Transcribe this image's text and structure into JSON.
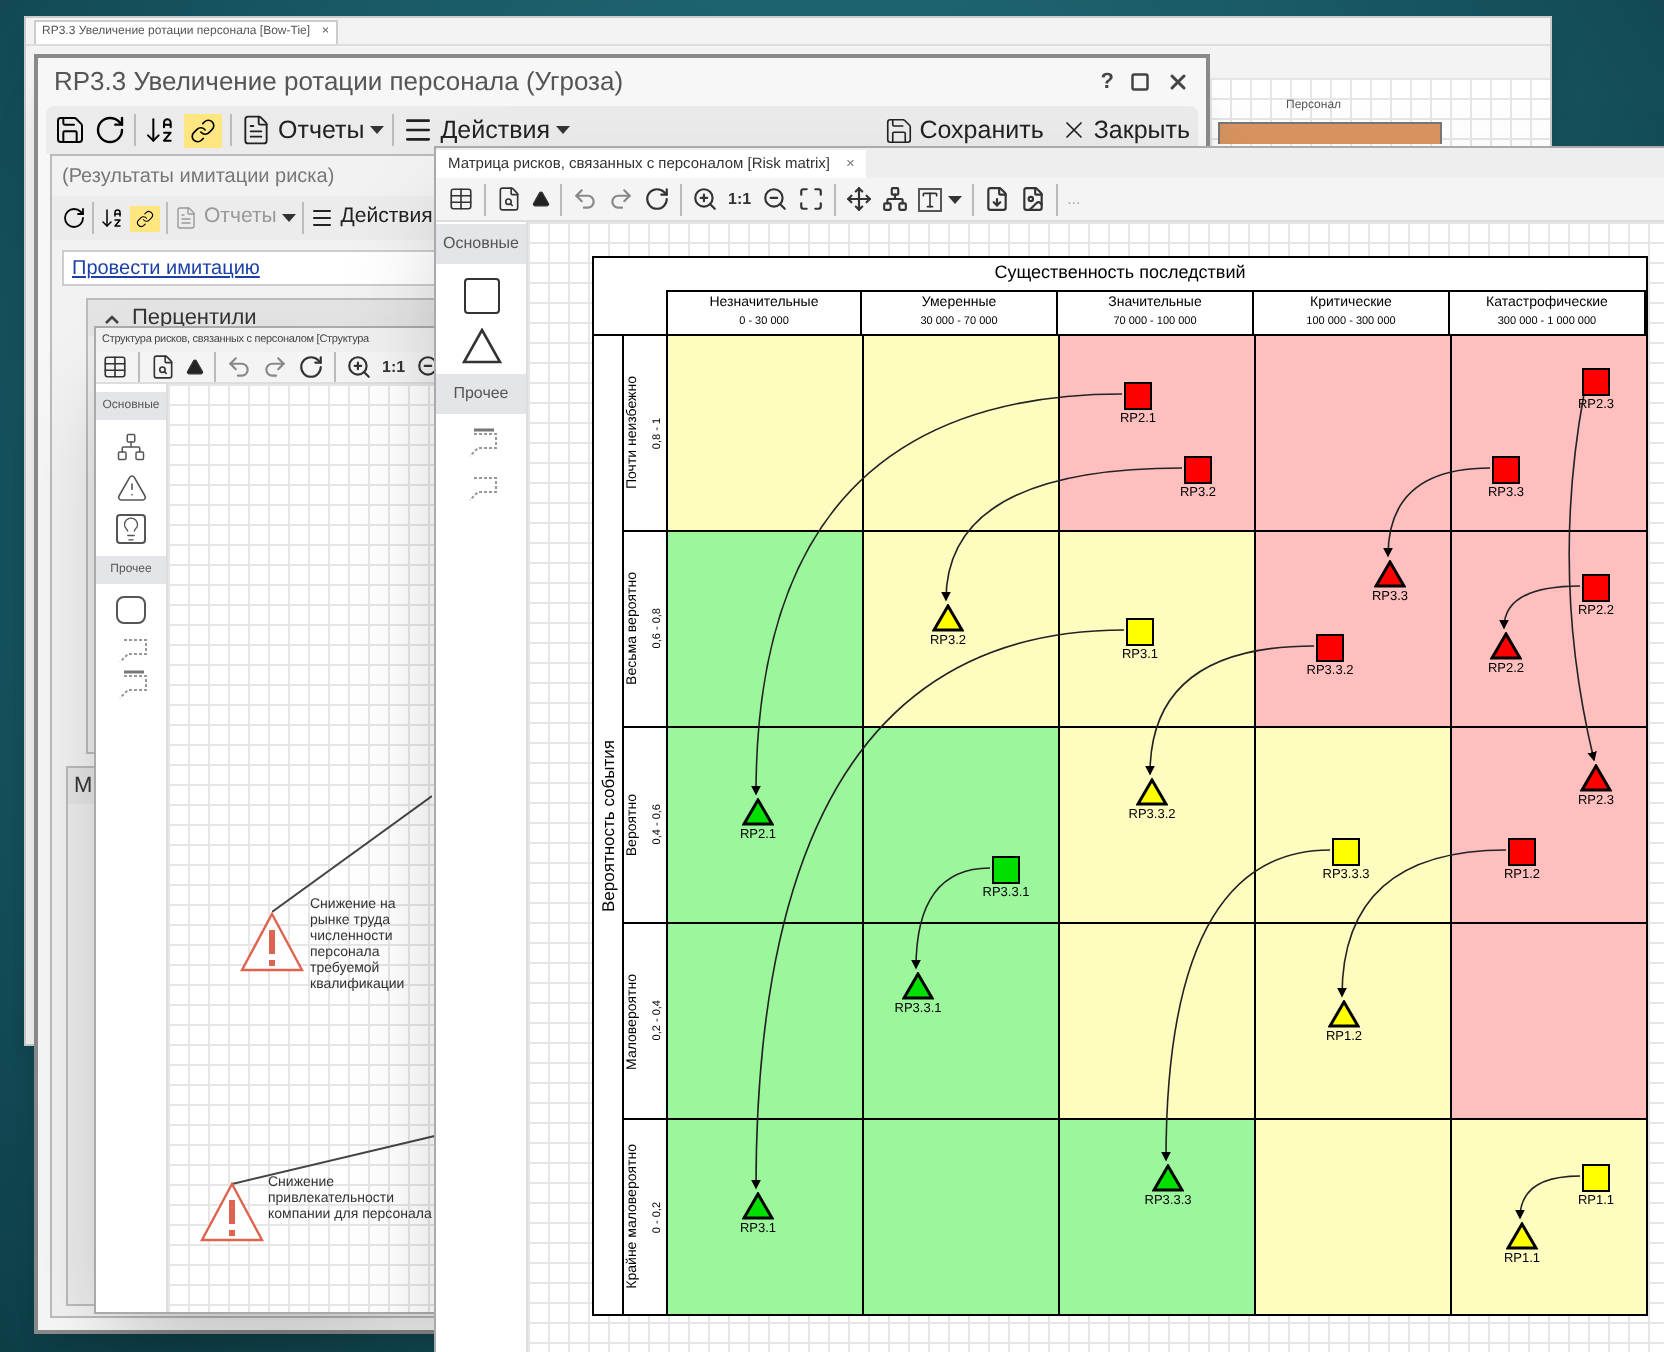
{
  "background_window": {
    "tab": "RP3.3 Увеличение ротации персонала [Bow-Tie]",
    "tab_close": "×",
    "diagram_node": "Персонал"
  },
  "dialog": {
    "title": "RP3.3 Увеличение ротации персонала (Угроза)",
    "help": "?",
    "toolbar": {
      "link_on": true,
      "reports": "Отчеты",
      "actions": "Действия",
      "save": "Сохранить",
      "close": "Закрыть"
    }
  },
  "results_panel": {
    "title": "(Результаты имитации риска)",
    "toolbar": {
      "link_on": true,
      "reports": "Отчеты",
      "reports_disabled": true,
      "actions": "Действия"
    },
    "run_link": "Провести имитацию",
    "sections": [
      {
        "title": "Перцентили",
        "expanded": true
      },
      {
        "title": "М"
      }
    ]
  },
  "structure_window": {
    "title": "Структура рисков, связанных с персоналом [Структура",
    "zoom_label": "1:1",
    "palette": [
      "Основные",
      "Прочее"
    ],
    "nodes": [
      {
        "text": "Снижение на рынке труда численности персонала требуемой квалификации"
      },
      {
        "text": "Снижение привлекательности компании для персонала"
      }
    ]
  },
  "matrix_window": {
    "title": "Матрица рисков, связанных с персоналом [Risk matrix]",
    "tab_close": "×",
    "zoom_label": "1:1",
    "more": "...",
    "palette": [
      "Основные",
      "Прочее"
    ],
    "matrix": {
      "title": "Существенность последствий",
      "axis_label": "Вероятность события",
      "columns": [
        {
          "name": "Незначительные",
          "range": "0 - 30 000"
        },
        {
          "name": "Умеренные",
          "range": "30 000 - 70 000"
        },
        {
          "name": "Значительные",
          "range": "70 000 - 100 000"
        },
        {
          "name": "Критические",
          "range": "100 000 - 300 000"
        },
        {
          "name": "Катастрофические",
          "range": "300 000 - 1 000 000"
        }
      ],
      "rows": [
        {
          "name": "Почти неизбежно",
          "range": "0,8 - 1",
          "cells": [
            {
              "color": "#fffcc0"
            },
            {
              "color": "#fffcc0"
            },
            {
              "color": "#ffbfbf",
              "markers": [
                {
                  "kind": "square",
                  "color": "#ff0000",
                  "label": "RP2.1"
                },
                {
                  "kind": "square",
                  "color": "#ff0000",
                  "label": "RP3.2"
                }
              ]
            },
            {
              "color": "#ffbfbf"
            },
            {
              "color": "#ffbfbf",
              "markers": [
                {
                  "kind": "square",
                  "color": "#ff0000",
                  "label": "RP2.3"
                },
                {
                  "kind": "square",
                  "color": "#ff0000",
                  "label": "RP3.3"
                }
              ]
            }
          ]
        },
        {
          "name": "Весьма вероятно",
          "range": "0,6 - 0,8",
          "cells": [
            {
              "color": "#9cf79c"
            },
            {
              "color": "#fffcc0",
              "markers": [
                {
                  "kind": "triangle",
                  "color": "#ffff00",
                  "label": "RP3.2"
                }
              ]
            },
            {
              "color": "#fffcc0",
              "markers": [
                {
                  "kind": "square",
                  "color": "#ffff00",
                  "label": "RP3.1"
                }
              ]
            },
            {
              "color": "#ffbfbf",
              "markers": [
                {
                  "kind": "triangle",
                  "color": "#ff0000",
                  "label": "RP3.3"
                },
                {
                  "kind": "square",
                  "color": "#ff0000",
                  "label": "RP3.3.2"
                }
              ]
            },
            {
              "color": "#ffbfbf",
              "markers": [
                {
                  "kind": "square",
                  "color": "#ff0000",
                  "label": "RP2.2"
                },
                {
                  "kind": "triangle",
                  "color": "#ff0000",
                  "label": "RP2.2"
                }
              ]
            }
          ]
        },
        {
          "name": "Вероятно",
          "range": "0,4 - 0,6",
          "cells": [
            {
              "color": "#9cf79c",
              "markers": [
                {
                  "kind": "triangle",
                  "color": "#00e000",
                  "label": "RP2.1"
                }
              ]
            },
            {
              "color": "#9cf79c",
              "markers": [
                {
                  "kind": "square",
                  "color": "#00e000",
                  "label": "RP3.3.1"
                }
              ]
            },
            {
              "color": "#fffcc0",
              "markers": [
                {
                  "kind": "triangle",
                  "color": "#ffff00",
                  "label": "RP3.3.2"
                }
              ]
            },
            {
              "color": "#fffcc0",
              "markers": [
                {
                  "kind": "square",
                  "color": "#ffff00",
                  "label": "RP3.3.3"
                }
              ]
            },
            {
              "color": "#ffbfbf",
              "markers": [
                {
                  "kind": "triangle",
                  "color": "#ff0000",
                  "label": "RP2.3"
                },
                {
                  "kind": "square",
                  "color": "#ff0000",
                  "label": "RP1.2"
                }
              ]
            }
          ]
        },
        {
          "name": "Маловероятно",
          "range": "0,2 - 0,4",
          "cells": [
            {
              "color": "#9cf79c"
            },
            {
              "color": "#9cf79c",
              "markers": [
                {
                  "kind": "triangle",
                  "color": "#00e000",
                  "label": "RP3.3.1"
                }
              ]
            },
            {
              "color": "#fffcc0"
            },
            {
              "color": "#fffcc0",
              "markers": [
                {
                  "kind": "triangle",
                  "color": "#ffff00",
                  "label": "RP1.2"
                }
              ]
            },
            {
              "color": "#ffbfbf"
            }
          ]
        },
        {
          "name": "Крайне маловероятно",
          "range": "0 - 0,2",
          "cells": [
            {
              "color": "#9cf79c",
              "markers": [
                {
                  "kind": "triangle",
                  "color": "#00e000",
                  "label": "RP3.1"
                }
              ]
            },
            {
              "color": "#9cf79c"
            },
            {
              "color": "#9cf79c",
              "markers": [
                {
                  "kind": "triangle",
                  "color": "#00e000",
                  "label": "RP3.3.3"
                }
              ]
            },
            {
              "color": "#fffcc0"
            },
            {
              "color": "#fffcc0",
              "markers": [
                {
                  "kind": "square",
                  "color": "#ffff00",
                  "label": "RP1.1"
                },
                {
                  "kind": "triangle",
                  "color": "#ffff00",
                  "label": "RP1.1"
                }
              ]
            }
          ]
        }
      ]
    }
  }
}
